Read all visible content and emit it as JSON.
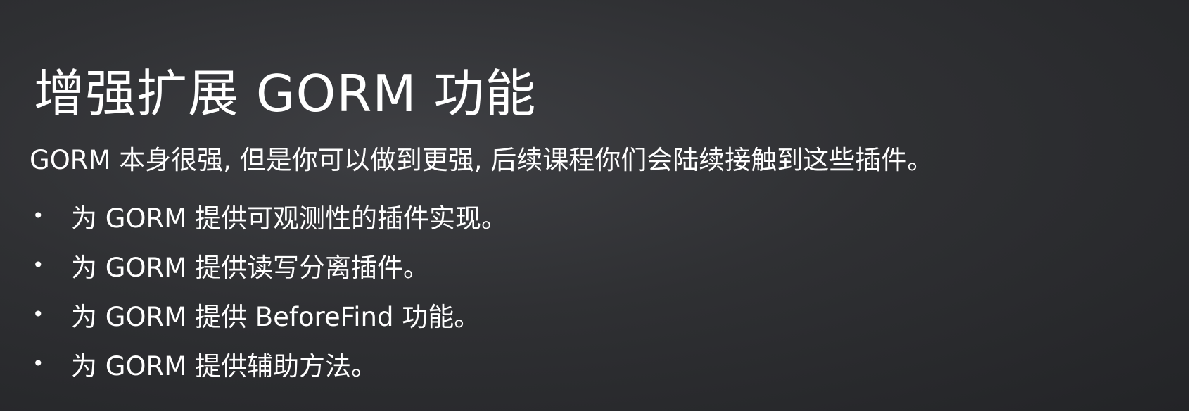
{
  "slide": {
    "title": "增强扩展 GORM 功能",
    "intro": "GORM 本身很强, 但是你可以做到更强, 后续课程你们会陆续接触到这些插件。",
    "bullet_symbol": "•",
    "bullets": [
      "为 GORM 提供可观测性的插件实现。",
      "为 GORM 提供读写分离插件。",
      "为 GORM 提供 BeforeFind 功能。",
      "为 GORM 提供辅助方法。"
    ]
  }
}
